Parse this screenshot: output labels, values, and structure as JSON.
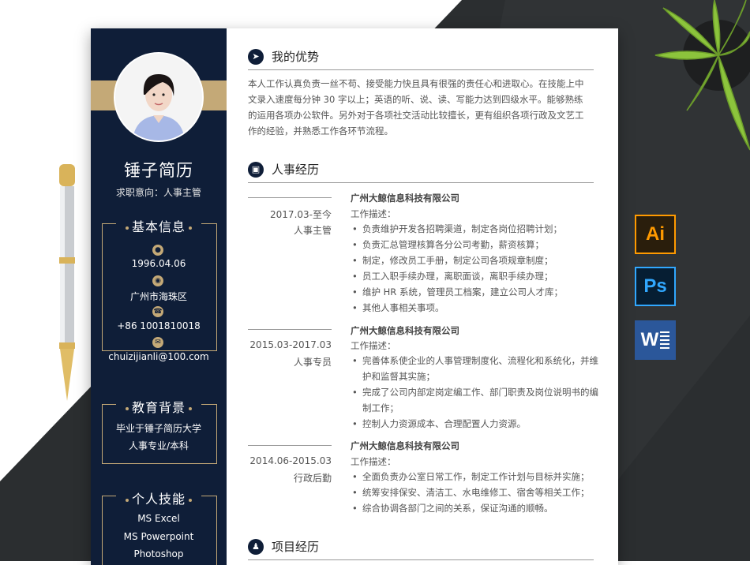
{
  "sidebar": {
    "name": "锤子简历",
    "intent": "求职意向：人事主管",
    "basic": {
      "title": "基本信息",
      "birthday": "1996.04.06",
      "location": "广州市海珠区",
      "phone": "+86 1001810018",
      "email": "chuizijianli@100.com"
    },
    "education": {
      "title": "教育背景",
      "line1": "毕业于锤子简历大学",
      "line2": "人事专业/本科"
    },
    "skills": {
      "title": "个人技能",
      "items": [
        "MS Excel",
        "MS Powerpoint",
        "Photoshop"
      ]
    }
  },
  "advantages": {
    "title": "我的优势",
    "lines": [
      "本人工作认真负责一丝不苟、接受能力快且具有很强的责任心和进取心。在技能上中",
      "文录入速度每分钟 30 字以上；英语的听、说、读、写能力达到四级水平。能够熟练",
      "的运用各项办公软件。另外对于各项社交活动比较擅长，更有组织各项行政及文艺工",
      "作的经验，并熟悉工作各环节流程。"
    ]
  },
  "experience": {
    "title": "人事经历",
    "jobs": [
      {
        "date": "2017.03-至今",
        "role": "人事主管",
        "company": "广州大鲸信息科技有限公司",
        "desc_label": "工作描述：",
        "bullets": [
          "负责维护开发各招聘渠道，制定各岗位招聘计划；",
          "负责汇总管理核算各分公司考勤，薪资核算；",
          "制定，修改员工手册，制定公司各项规章制度；",
          "员工入职手续办理，离职面谈，离职手续办理；",
          "维护 HR 系统，管理员工档案，建立公司人才库；",
          "其他人事相关事项。"
        ]
      },
      {
        "date": "2015.03-2017.03",
        "role": "人事专员",
        "company": "广州大鲸信息科技有限公司",
        "desc_label": "工作描述：",
        "bullets": [
          "完善体系使企业的人事管理制度化、流程化和系统化，并维护和监督其实施；",
          "完成了公司内部定岗定编工作、部门职责及岗位说明书的编制工作；",
          "控制人力资源成本、合理配置人力资源。"
        ]
      },
      {
        "date": "2014.06-2015.03",
        "role": "行政后勤",
        "company": "广州大鲸信息科技有限公司",
        "desc_label": "工作描述：",
        "bullets": [
          "全面负责办公室日常工作，制定工作计划与目标并实施；",
          "统筹安排保安、清洁工、水电维修工、宿舍等相关工作；",
          "综合协调各部门之间的关系，保证沟通的顺畅。"
        ]
      }
    ]
  },
  "projects": {
    "title": "项目经历"
  },
  "software": {
    "ai": "Ai",
    "ps": "Ps",
    "word": "W"
  },
  "colors": {
    "navy": "#0f1e38",
    "gold": "#c4a977"
  }
}
